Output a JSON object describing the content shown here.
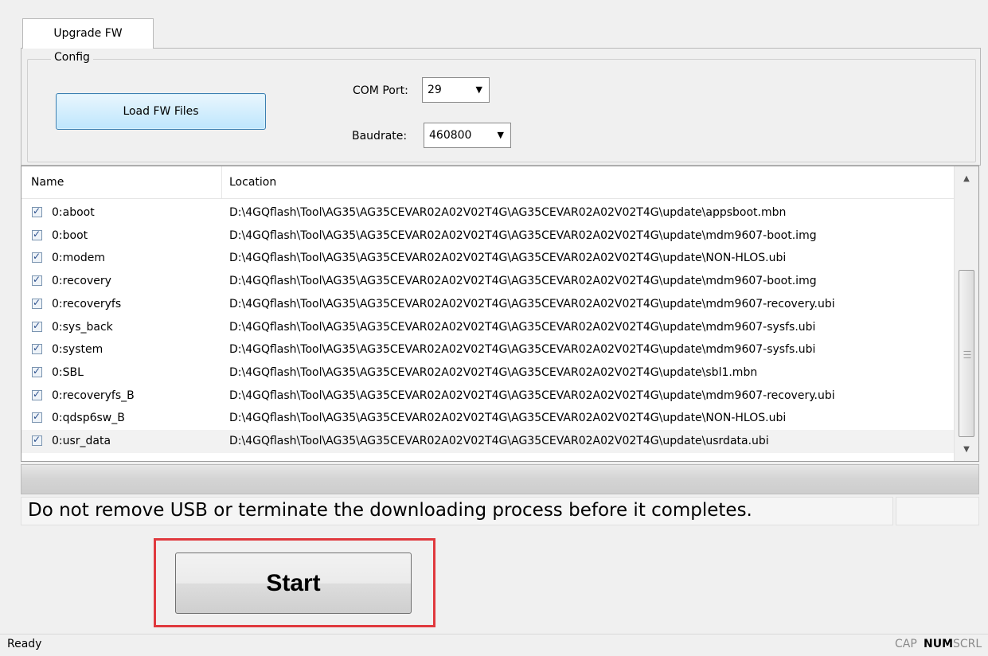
{
  "tab": {
    "label": "Upgrade FW"
  },
  "config": {
    "group_label": "Config",
    "load_button_label": "Load FW Files",
    "com_port_label": "COM Port:",
    "com_port_value": "29",
    "baudrate_label": "Baudrate:",
    "baudrate_value": "460800"
  },
  "list": {
    "columns": [
      "Name",
      "Location"
    ],
    "rows": [
      {
        "checked": true,
        "name": "0:aboot",
        "location": "D:\\4GQflash\\Tool\\AG35\\AG35CEVAR02A02V02T4G\\AG35CEVAR02A02V02T4G\\update\\appsboot.mbn"
      },
      {
        "checked": true,
        "name": "0:boot",
        "location": "D:\\4GQflash\\Tool\\AG35\\AG35CEVAR02A02V02T4G\\AG35CEVAR02A02V02T4G\\update\\mdm9607-boot.img"
      },
      {
        "checked": true,
        "name": "0:modem",
        "location": "D:\\4GQflash\\Tool\\AG35\\AG35CEVAR02A02V02T4G\\AG35CEVAR02A02V02T4G\\update\\NON-HLOS.ubi"
      },
      {
        "checked": true,
        "name": "0:recovery",
        "location": "D:\\4GQflash\\Tool\\AG35\\AG35CEVAR02A02V02T4G\\AG35CEVAR02A02V02T4G\\update\\mdm9607-boot.img"
      },
      {
        "checked": true,
        "name": "0:recoveryfs",
        "location": "D:\\4GQflash\\Tool\\AG35\\AG35CEVAR02A02V02T4G\\AG35CEVAR02A02V02T4G\\update\\mdm9607-recovery.ubi"
      },
      {
        "checked": true,
        "name": "0:sys_back",
        "location": "D:\\4GQflash\\Tool\\AG35\\AG35CEVAR02A02V02T4G\\AG35CEVAR02A02V02T4G\\update\\mdm9607-sysfs.ubi"
      },
      {
        "checked": true,
        "name": "0:system",
        "location": "D:\\4GQflash\\Tool\\AG35\\AG35CEVAR02A02V02T4G\\AG35CEVAR02A02V02T4G\\update\\mdm9607-sysfs.ubi"
      },
      {
        "checked": true,
        "name": "0:SBL",
        "location": "D:\\4GQflash\\Tool\\AG35\\AG35CEVAR02A02V02T4G\\AG35CEVAR02A02V02T4G\\update\\sbl1.mbn"
      },
      {
        "checked": true,
        "name": "0:recoveryfs_B",
        "location": "D:\\4GQflash\\Tool\\AG35\\AG35CEVAR02A02V02T4G\\AG35CEVAR02A02V02T4G\\update\\mdm9607-recovery.ubi"
      },
      {
        "checked": true,
        "name": "0:qdsp6sw_B",
        "location": "D:\\4GQflash\\Tool\\AG35\\AG35CEVAR02A02V02T4G\\AG35CEVAR02A02V02T4G\\update\\NON-HLOS.ubi"
      },
      {
        "checked": true,
        "name": "0:usr_data",
        "location": "D:\\4GQflash\\Tool\\AG35\\AG35CEVAR02A02V02T4G\\AG35CEVAR02A02V02T4G\\update\\usrdata.ubi"
      }
    ]
  },
  "progress": {
    "value": 0
  },
  "message": "Do not remove USB or terminate the downloading process before it completes.",
  "start_button_label": "Start",
  "highlight_color": "#e0393e",
  "statusbar": {
    "status": "Ready",
    "indicators": [
      "CAP",
      "NUM",
      "SCRL"
    ]
  },
  "icons": {
    "scroll_up": "chevron-up-icon",
    "scroll_down": "chevron-down-icon",
    "dropdown": "caret-down-icon",
    "checkbox": "checkmark-icon"
  }
}
